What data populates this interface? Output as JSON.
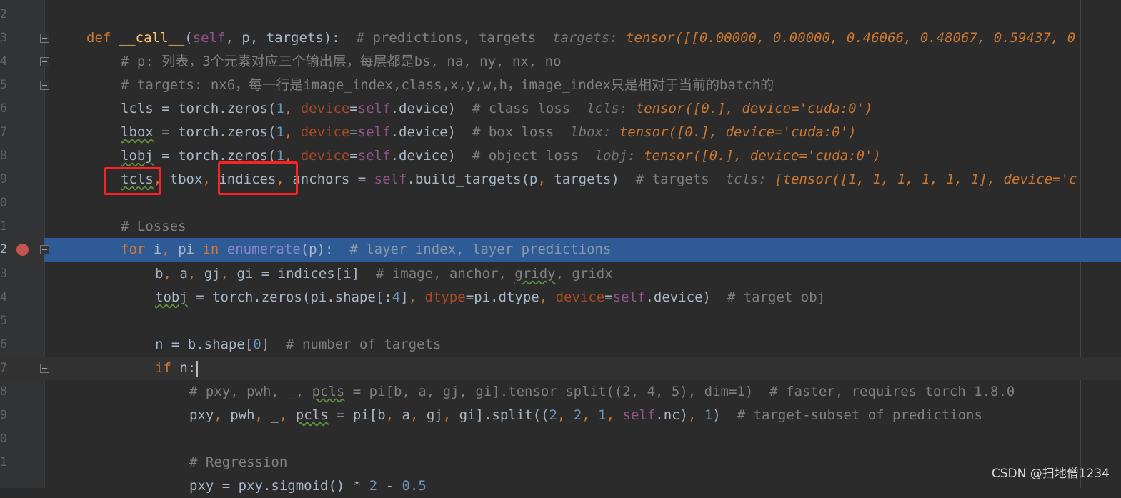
{
  "editor": {
    "line_numbers": [
      "2",
      "3",
      "4",
      "5",
      "6",
      "7",
      "8",
      "9",
      "0",
      "1",
      "2",
      "3",
      "4",
      "5",
      "6",
      "7",
      "8",
      "9",
      "0",
      "1"
    ]
  },
  "code": {
    "l3": {
      "def": "def ",
      "name": "__call__",
      "open": "(",
      "self": "self",
      "args": ", p, targets):  ",
      "comment": "# predictions, targets  ",
      "hint_k": "targets: ",
      "hint_v": "tensor([[0.00000, 0.00000, 0.46066, 0.48067, 0.59437, 0"
    },
    "l4": "# p: 列表，3个元素对应三个输出层，每层都是bs, na, ny, nx, no",
    "l5": "# targets: nx6，每一行是image_index,class,x,y,w,h，image_index只是相对于当前的batch的",
    "l6": {
      "var": "lcls",
      "rhs": " = torch.zeros(",
      "n": "1",
      "sep": ", ",
      "kw": "device",
      "eq": "=",
      "self": "self",
      "tail": ".device)  ",
      "comment": "# class loss  ",
      "hint_k": "lcls: ",
      "hint_v": "tensor([0.], device='cuda:0')"
    },
    "l7": {
      "var": "lbox",
      "rhs": " = torch.zeros(",
      "n": "1",
      "sep": ", ",
      "kw": "device",
      "eq": "=",
      "self": "self",
      "tail": ".device)  ",
      "comment": "# box loss  ",
      "hint_k": "lbox: ",
      "hint_v": "tensor([0.], device='cuda:0')"
    },
    "l8": {
      "var": "lobj",
      "rhs": " = torch.zeros(",
      "n": "1",
      "sep": ", ",
      "kw": "device",
      "eq": "=",
      "self": "self",
      "tail": ".device)  ",
      "comment": "# object loss  ",
      "hint_k": "lobj: ",
      "hint_v": "tensor([0.], device='cuda:0')"
    },
    "l9": {
      "tcls": "tcls",
      "c1": ", ",
      "tbox": "tbox",
      "c2": ", ",
      "indices": "indices",
      "c3": ", ",
      "anchors": "anchors = ",
      "self": "self",
      "call": ".build_targets(p",
      "c4": ", ",
      "rest": "targets)  ",
      "comment": "# targets  ",
      "hint_k": "tcls: ",
      "hint_v": "[tensor([1, 1, 1, 1, 1, 1], device='c"
    },
    "l11": "# Losses",
    "l12": {
      "for": "for ",
      "vars": "i",
      "c": ", ",
      "pi": "pi ",
      "in": "in ",
      "enum": "enumerate",
      "arg": "(p):  ",
      "comment": "# layer index, layer predictions"
    },
    "l13": {
      "a": "b",
      "c1": ", ",
      "b": "a",
      "c2": ", ",
      "c": "gj",
      "c3": ", ",
      "d": "gi = indices[i]  ",
      "comment": "# image, anchor, ",
      "gridy": "gridy",
      "comment2": ", gridx"
    },
    "l14": {
      "var": "tobj",
      "rhs": " = torch.zeros(pi.shape[:",
      "n": "4",
      "close": "]",
      "sep": ", ",
      "kw1": "dtype",
      "eq1": "=pi.dtype",
      "sep2": ", ",
      "kw2": "device",
      "eq2": "=",
      "self": "self",
      "tail": ".device)  ",
      "comment": "# target obj"
    },
    "l16": {
      "lhs": "n = b.shape[",
      "n": "0",
      "close": "]  ",
      "comment": "# number of targets"
    },
    "l17": {
      "if": "if ",
      "rest": "n:"
    },
    "l18": {
      "c1": "# pxy, pwh, _, ",
      "pcls": "pcls",
      "c2": " = pi[b, a, gj, gi].tensor_split((2, 4, 5), dim=1)  # faster, requires torch 1.8.0"
    },
    "l19": {
      "a": "pxy",
      "c1": ", ",
      "b": "pwh",
      "c2": ", ",
      "u": "_",
      "c3": ", ",
      "pcls": "pcls",
      "rest": " = pi[b",
      "c4": ", ",
      "r2": "a",
      "c5": ", ",
      "r3": "gj",
      "c6": ", ",
      "r4": "gi].split((",
      "n1": "2",
      "c7": ", ",
      "n2": "2",
      "c8": ", ",
      "n3": "1",
      "c9": ", ",
      "self": "self",
      "nc": ".nc)",
      "c10": ", ",
      "n4": "1",
      "close": ")  ",
      "comment": "# target-subset of predictions"
    },
    "l21": "# Regression",
    "l22": {
      "lhs": "pxy = pxy.sigmoid() * ",
      "n1": "2",
      "mid": " - ",
      "n2": "0.5"
    }
  },
  "watermark": "CSDN @扫地僧1234"
}
